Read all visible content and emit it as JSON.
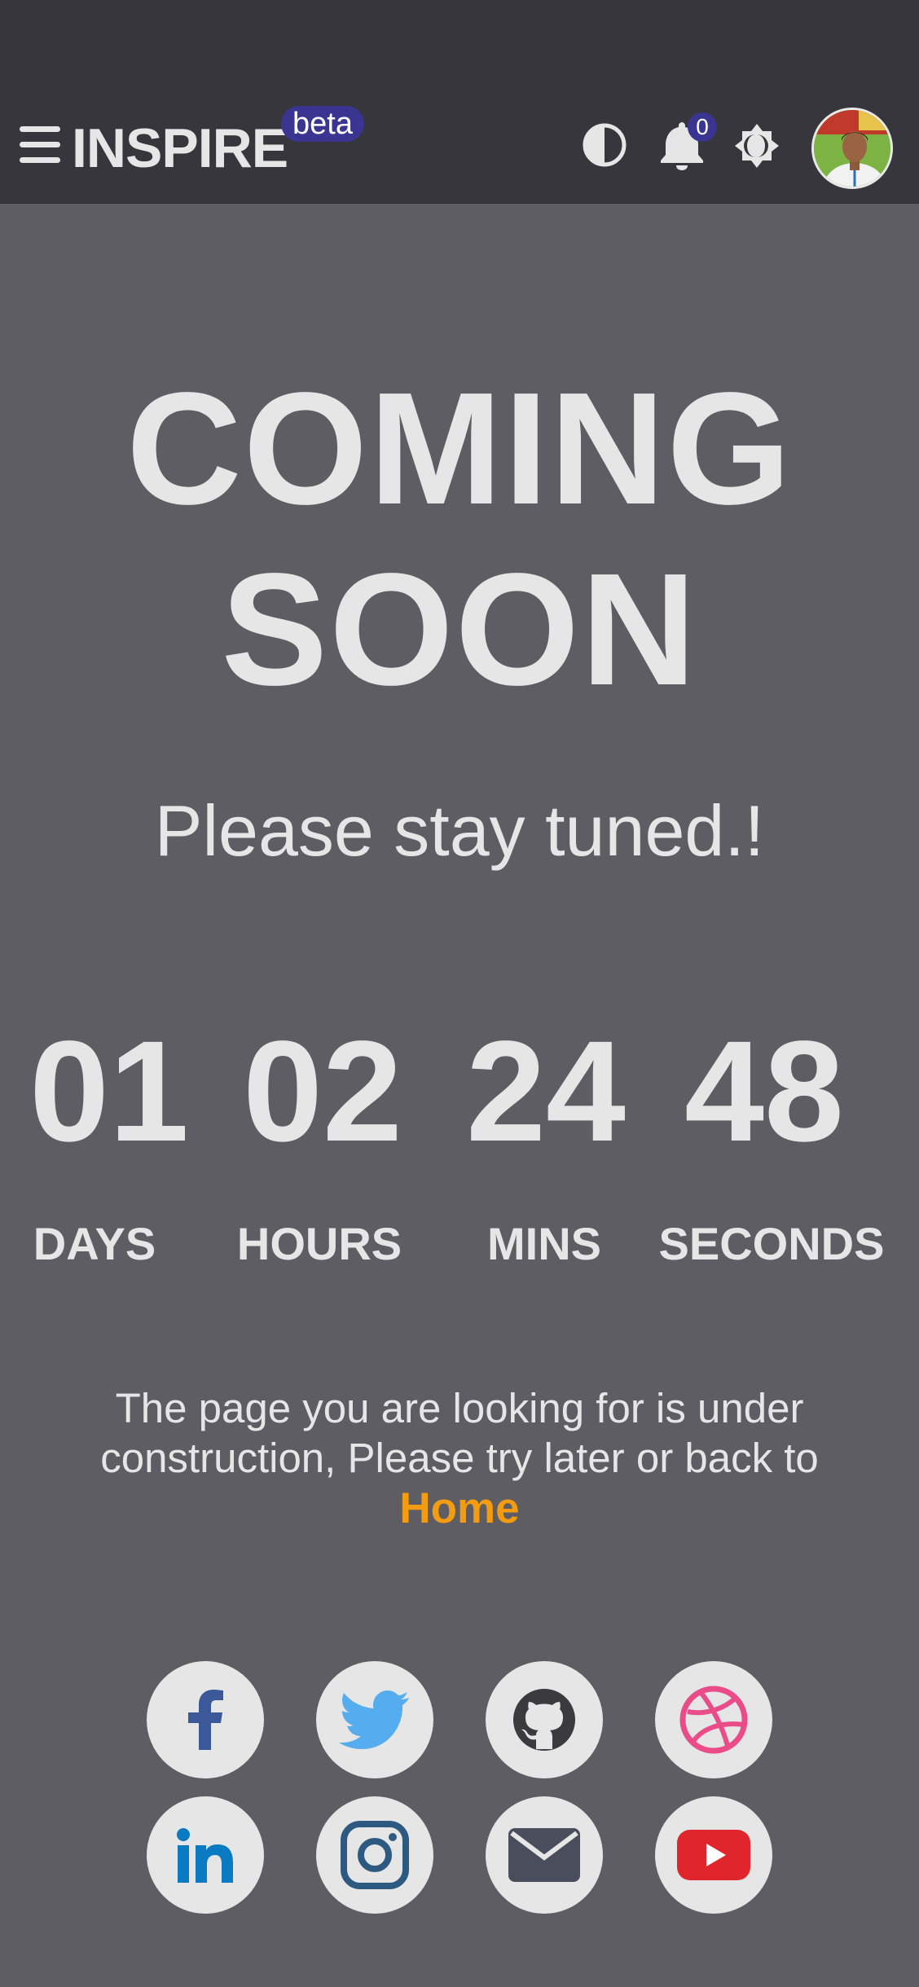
{
  "header": {
    "brand": "INSPIRE",
    "badge": "beta",
    "notification_count": "0",
    "icons": [
      "menu-icon",
      "contrast-icon",
      "bell-icon",
      "brightness-icon",
      "avatar"
    ]
  },
  "main": {
    "title_line1": "COMING",
    "title_line2": "SOON",
    "subtitle": "Please stay tuned.!",
    "countdown": [
      {
        "value": "01",
        "label": "DAYS"
      },
      {
        "value": "02",
        "label": "HOURS"
      },
      {
        "value": "24",
        "label": "MINS"
      },
      {
        "value": "48",
        "label": "SECONDS"
      }
    ],
    "message_line1": "The page you are looking for is under",
    "message_line2": "construction, Please try later or back to",
    "home_link": "Home"
  },
  "social": [
    {
      "name": "facebook",
      "icon": "facebook-icon",
      "color": "#3b5998"
    },
    {
      "name": "twitter",
      "icon": "twitter-icon",
      "color": "#55acee"
    },
    {
      "name": "github",
      "icon": "github-icon",
      "color": "#3a3a3f"
    },
    {
      "name": "dribbble",
      "icon": "dribbble-icon",
      "color": "#ea4c89"
    },
    {
      "name": "linkedin",
      "icon": "linkedin-icon",
      "color": "#0a7ac2"
    },
    {
      "name": "instagram",
      "icon": "instagram-icon",
      "color": "#2e5a82"
    },
    {
      "name": "email",
      "icon": "email-icon",
      "color": "#4a4d5c"
    },
    {
      "name": "youtube",
      "icon": "youtube-icon",
      "color": "#e0262c"
    }
  ],
  "colors": {
    "background": "#5e5d63",
    "header": "#37363c",
    "text": "#e6e6e6",
    "accent": "#f39c12",
    "badge": "#3a3590"
  }
}
